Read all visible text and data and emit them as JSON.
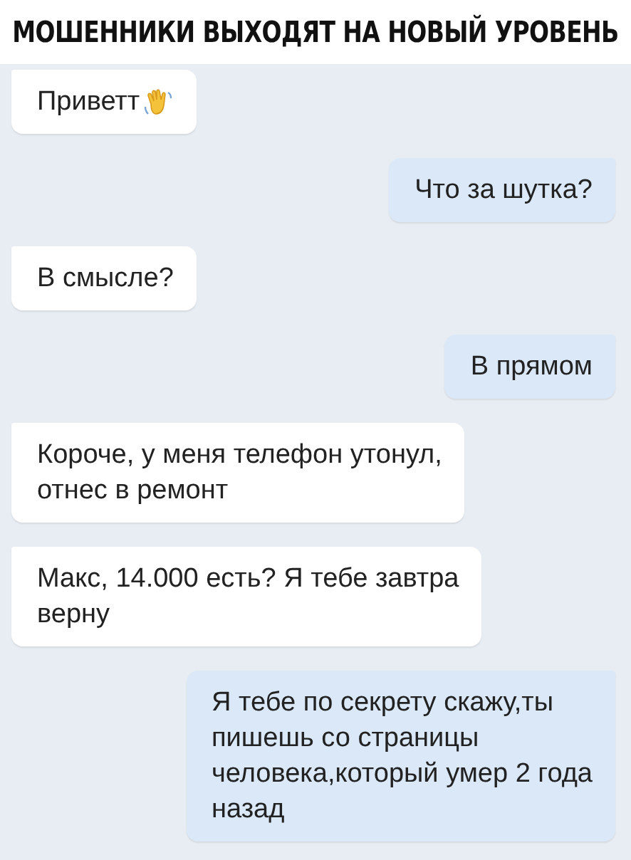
{
  "caption": "МОШЕННИКИ ВЫХОДЯТ НА НОВЫЙ УРОВЕНЬ",
  "messages": [
    {
      "kind": "incoming",
      "text": "Приветт",
      "wave": true
    },
    {
      "kind": "outgoing",
      "text": "Что за шутка?"
    },
    {
      "kind": "incoming",
      "text": "В смысле?"
    },
    {
      "kind": "outgoing",
      "text": "В прямом"
    },
    {
      "kind": "incoming",
      "text": "Короче, у меня телефон утонул,\nотнес в ремонт"
    },
    {
      "kind": "incoming",
      "text": "Макс, 14.000 есть? Я тебе завтра\nверну"
    },
    {
      "kind": "outgoing",
      "text": "Я тебе по секрету скажу,ты\nпишешь со страницы\nчеловека,который умер 2 года\nназад"
    }
  ]
}
